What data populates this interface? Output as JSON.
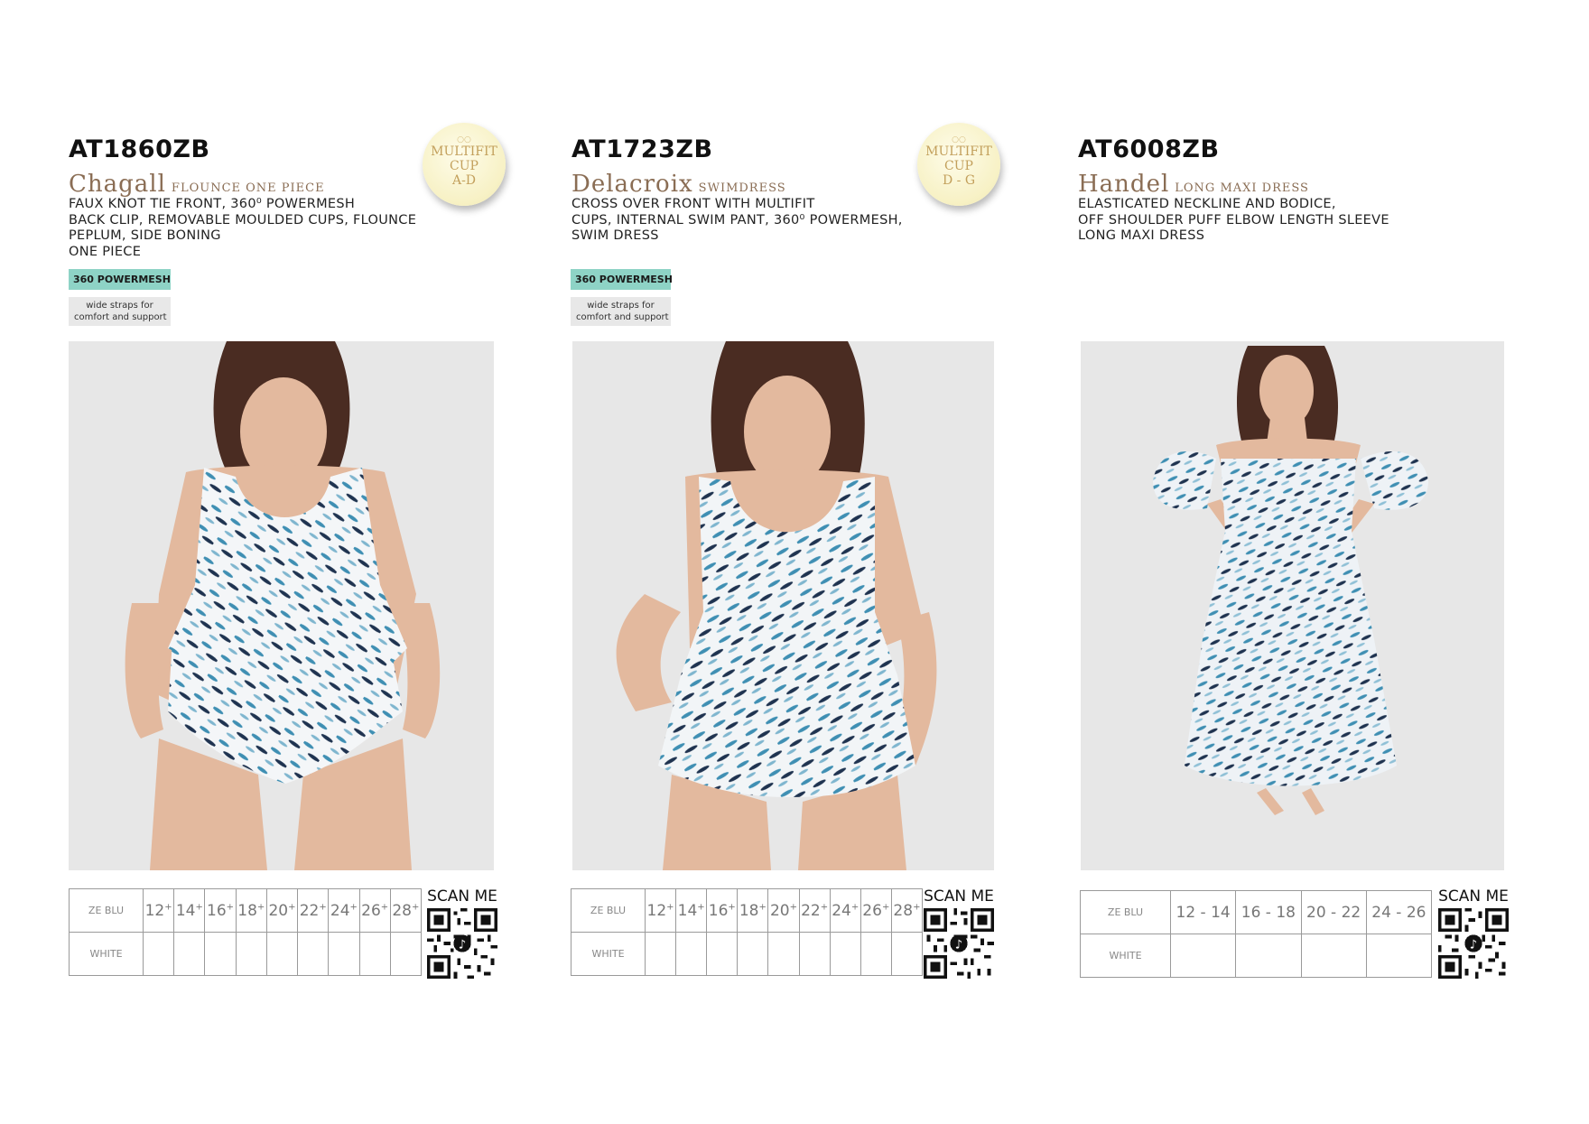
{
  "products": [
    {
      "code": "AT1860ZB",
      "name": "Chagall",
      "style": "Flounce One Piece",
      "description": [
        "Faux knot tie front, 360⁰ powermesh",
        "back clip, removable moulded cups, flounce",
        "peplum, side boning",
        "one piece"
      ],
      "cup_badge": {
        "line1": "MULTIFIT",
        "line2": "CUP",
        "line3": "A-D"
      },
      "tag_mesh": "360 POWERMESH",
      "tag_straps": [
        "wide straps for",
        "comfort and support"
      ],
      "colours": [
        "ZE BLU",
        "WHITE"
      ],
      "sizes": [
        "12",
        "14",
        "16",
        "18",
        "20",
        "22",
        "24",
        "26",
        "28"
      ],
      "size_suffix": "+",
      "scan_label": "SCAN ME"
    },
    {
      "code": "AT1723ZB",
      "name": "Delacroix",
      "style": "Swimdress",
      "description": [
        "Cross over front with multifit",
        "cups, internal swim pant, 360⁰ powermesh,",
        "swim dress"
      ],
      "cup_badge": {
        "line1": "MULTIFIT",
        "line2": "CUP",
        "line3": "D - G"
      },
      "tag_mesh": "360 POWERMESH",
      "tag_straps": [
        "wide straps for",
        "comfort and support"
      ],
      "colours": [
        "ZE BLU",
        "WHITE"
      ],
      "sizes": [
        "12",
        "14",
        "16",
        "18",
        "20",
        "22",
        "24",
        "26",
        "28"
      ],
      "size_suffix": "+",
      "scan_label": "SCAN ME"
    },
    {
      "code": "AT6008ZB",
      "name": "Handel",
      "style": "Long Maxi Dress",
      "description": [
        "Elasticated neckline and bodice,",
        "off shoulder puff elbow length sleeve",
        "long maxi dress"
      ],
      "colours": [
        "ZE BLU",
        "WHITE"
      ],
      "sizes": [
        "12 - 14",
        "16 - 18",
        "20 - 22",
        "24 - 26"
      ],
      "scan_label": "SCAN ME"
    }
  ],
  "colors": {
    "name_brown": "#8a6d54",
    "mesh_teal": "#8ed3c6",
    "print_blue": "#3f8fb3",
    "print_navy": "#1f3350",
    "photo_bg": "#e7e7e7"
  },
  "icons": {
    "qr": "qr-code-icon",
    "tiktok": "tiktok-icon"
  }
}
